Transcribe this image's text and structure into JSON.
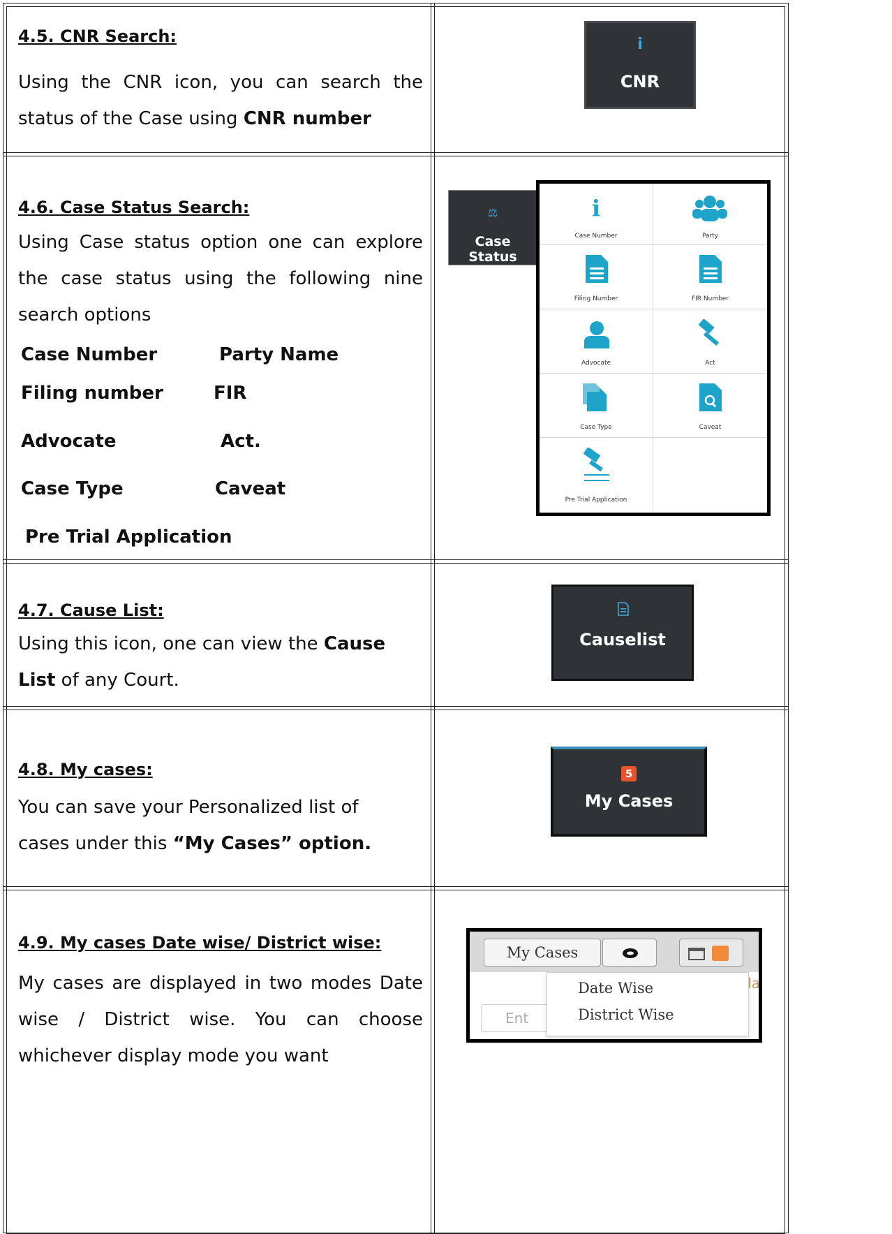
{
  "sections": {
    "cnr": {
      "heading": "4.5. CNR Search:",
      "text_1": " Using the CNR icon, you can search the status of the Case using ",
      "text_bold": "CNR number",
      "image": {
        "icon": "info-icon",
        "label": "CNR"
      }
    },
    "case_status": {
      "heading": "4.6. Case Status Search:",
      "text": "Using Case status option one can explore the case status using the following nine search options",
      "options": [
        "Case Number",
        "Party Name",
        "Filing number",
        "FIR",
        "Advocate",
        "Act.",
        "Case Type",
        "Caveat",
        "Pre Trial Application"
      ],
      "image": {
        "button_label": "Case Status",
        "button_icon": "scales-icon",
        "grid": [
          {
            "label": "Case Number",
            "icon": "info-icon"
          },
          {
            "label": "Party",
            "icon": "people-icon"
          },
          {
            "label": "Filing Number",
            "icon": "document-icon"
          },
          {
            "label": "FIR Number",
            "icon": "fir-document-icon"
          },
          {
            "label": "Advocate",
            "icon": "advocate-icon"
          },
          {
            "label": "Act",
            "icon": "gavel-icon"
          },
          {
            "label": "Case Type",
            "icon": "case-type-icon"
          },
          {
            "label": "Caveat",
            "icon": "search-document-icon"
          },
          {
            "label": "Pre Trial Application",
            "icon": "pre-trial-icon"
          }
        ]
      }
    },
    "cause_list": {
      "heading": "4.7. Cause List:",
      "text_1": "Using this icon, one can view the ",
      "text_bold_1": "Cause",
      "text_bold_2": "List",
      "text_2": " of any Court.",
      "image": {
        "icon": "document-icon",
        "label": "Causelist"
      }
    },
    "my_cases": {
      "heading": "4.8. My cases:",
      "text_1": "You can save your Personalized list of",
      "text_2": "cases under this ",
      "text_bold": "“My Cases” option.",
      "image": {
        "badge": "5",
        "label": "My Cases",
        "badge_color": "#e8532a"
      }
    },
    "my_cases_mode": {
      "heading": "4.9. My cases Date wise/ District wise:",
      "text": "My cases are displayed in two modes Date wise / District wise. You can choose whichever display mode you want",
      "image": {
        "tab_label": "My Cases",
        "eye_icon": "eye-icon",
        "calendar_icon": "calendar-icon",
        "input_placeholder": "Ent",
        "dropdown_items": [
          "Date Wise",
          "District Wise"
        ],
        "cut_text": "la"
      }
    }
  }
}
